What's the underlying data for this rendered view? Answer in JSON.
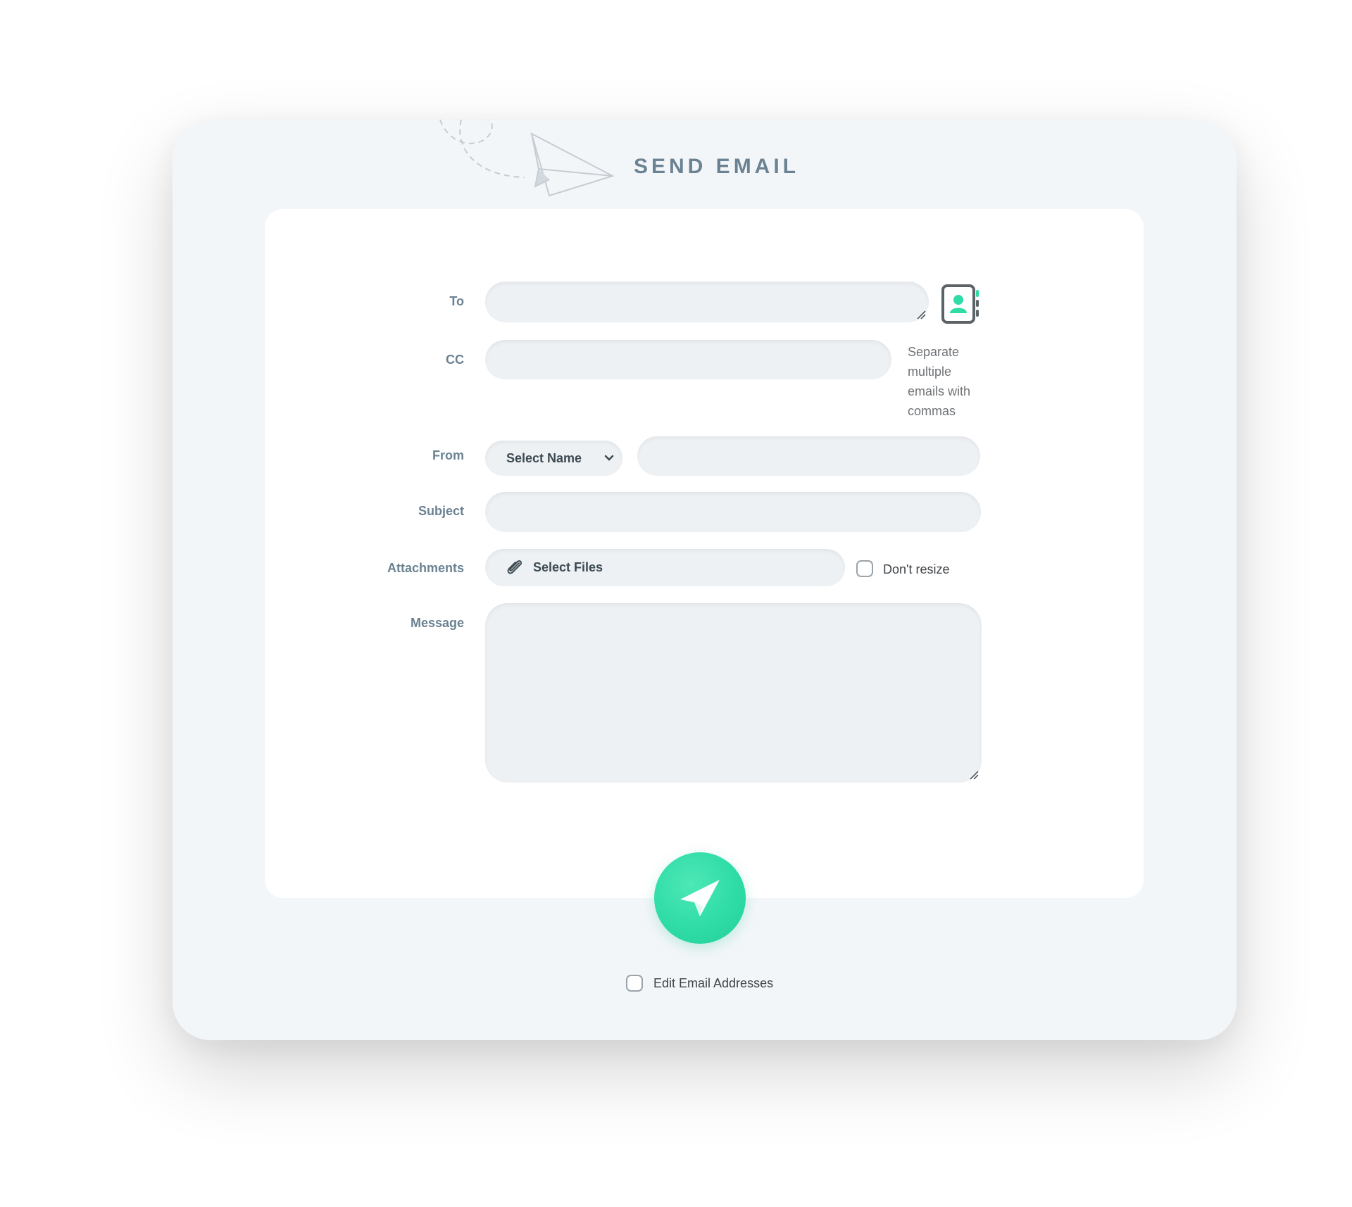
{
  "header": {
    "title": "SEND EMAIL",
    "decoration_icon": "paper-plane-icon"
  },
  "form": {
    "to": {
      "label": "To",
      "value": ""
    },
    "cc": {
      "label": "CC",
      "value": "",
      "helper": "Separate multiple emails with commas"
    },
    "from": {
      "label": "From",
      "select_value": "Select Name",
      "email_value": ""
    },
    "subject": {
      "label": "Subject",
      "value": ""
    },
    "attachments": {
      "label": "Attachments",
      "button_label": "Select Files",
      "dont_resize_label": "Don't resize",
      "dont_resize_checked": false
    },
    "message": {
      "label": "Message",
      "value": ""
    }
  },
  "footer": {
    "send_icon": "paper-plane-icon",
    "edit_addresses_label": "Edit Email Addresses",
    "edit_addresses_checked": false
  },
  "colors": {
    "accent": "#2fdca6",
    "label": "#6b8292",
    "panel": "#f3f6f9",
    "card": "#ffffff",
    "field": "#eef1f4"
  },
  "icons": {
    "contacts": "address-book-icon",
    "attach": "paperclip-icon",
    "select": "chevron-down-icon"
  }
}
